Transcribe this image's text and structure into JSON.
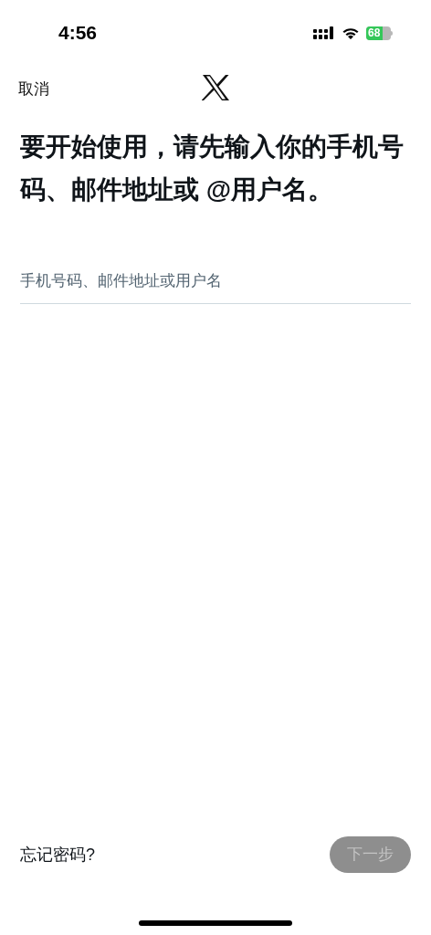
{
  "status_bar": {
    "time": "4:56",
    "battery": "68"
  },
  "header": {
    "cancel": "取消"
  },
  "heading": "要开始使用，请先输入你的手机号码、邮件地址或 @用户名。",
  "input": {
    "placeholder": "手机号码、邮件地址或用户名"
  },
  "footer": {
    "forgot": "忘记密码?",
    "next": {
      "label": "下一步",
      "disabled": true
    }
  }
}
